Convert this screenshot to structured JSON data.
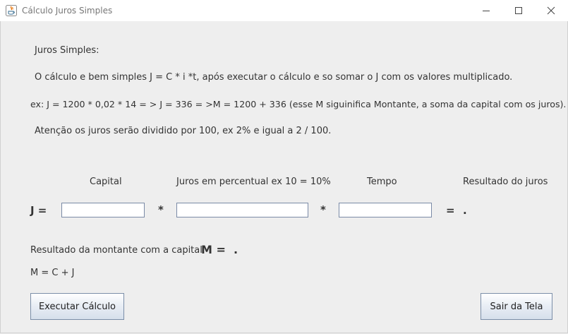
{
  "window": {
    "title": "Cálculo Juros Simples"
  },
  "info": {
    "heading": "Juros Simples:",
    "line1": "O cálculo e bem simples J = C * i *t, após executar o cálculo e so somar o J com os valores multiplicado.",
    "line2": "ex: J = 1200 * 0,02 * 14 = > J = 336 = >M = 1200 + 336 (esse M siguinifica Montante, a soma da capital com os juros).",
    "line3": "Atenção os juros serão dividido por 100, ex 2% e igual a 2 / 100."
  },
  "columns": {
    "capital": "Capital",
    "juros": "Juros em percentual ex 10 = 10%",
    "tempo": "Tempo",
    "resultado": "Resultado do juros"
  },
  "formula": {
    "j_label": "J =",
    "times1": "*",
    "times2": "*",
    "equals": "=",
    "result": ".",
    "capital_value": "",
    "juros_value": "",
    "tempo_value": ""
  },
  "montante": {
    "label": "Resultado da montante com a capital",
    "m_label": "M =",
    "result": ".",
    "formula": "M = C + J"
  },
  "buttons": {
    "executar": "Executar Cálculo",
    "sair": "Sair da Tela"
  }
}
